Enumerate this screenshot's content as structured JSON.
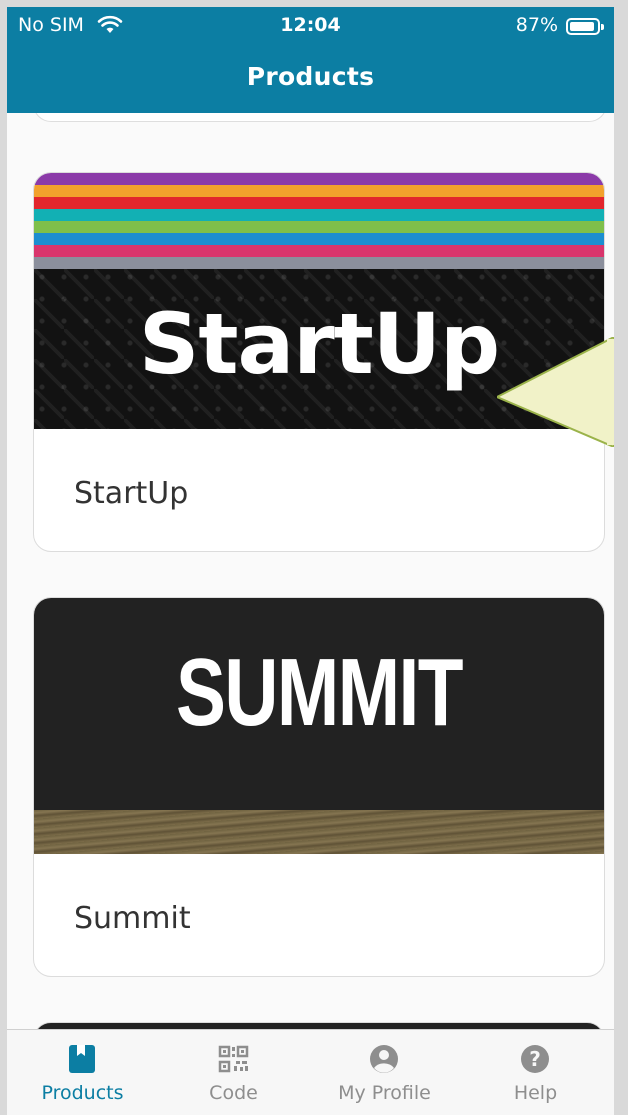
{
  "status_bar": {
    "carrier": "No SIM",
    "time": "12:04",
    "battery": "87%"
  },
  "header": {
    "title": "Products",
    "color": "#0c7ea3"
  },
  "products": [
    {
      "name": "StartUp",
      "banner_text": "StartUp",
      "stripe_colors": [
        "#8b3aa8",
        "#f2a12c",
        "#e2262c",
        "#12b0b4",
        "#7fbf4a",
        "#1c8ed0",
        "#d9356c",
        "#8b8f9c"
      ]
    },
    {
      "name": "Summit",
      "banner_text": "SUMMIT"
    }
  ],
  "tabs": [
    {
      "label": "Products",
      "icon": "book-icon",
      "active": true
    },
    {
      "label": "Code",
      "icon": "qr-code-icon",
      "active": false
    },
    {
      "label": "My Profile",
      "icon": "user-circle-icon",
      "active": false
    },
    {
      "label": "Help",
      "icon": "help-circle-icon",
      "active": false
    }
  ],
  "accent_color": "#0c7ea3"
}
